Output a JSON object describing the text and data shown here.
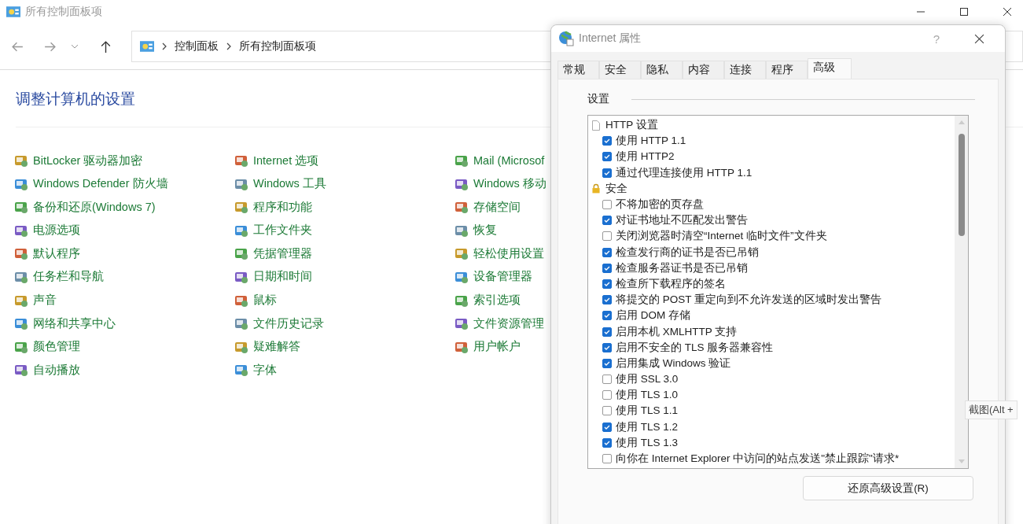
{
  "window": {
    "title": "所有控制面板项"
  },
  "address_bar": {
    "segments": [
      "控制面板",
      "所有控制面板项"
    ]
  },
  "heading": "调整计算机的设置",
  "items": [
    {
      "label": "BitLocker 驱动器加密"
    },
    {
      "label": "Windows Defender 防火墙"
    },
    {
      "label": "备份和还原(Windows 7)"
    },
    {
      "label": "电源选项"
    },
    {
      "label": "默认程序"
    },
    {
      "label": "任务栏和导航"
    },
    {
      "label": "声音"
    },
    {
      "label": "网络和共享中心"
    },
    {
      "label": "颜色管理"
    },
    {
      "label": "自动播放"
    },
    {
      "label": "Internet 选项"
    },
    {
      "label": "Windows 工具"
    },
    {
      "label": "程序和功能"
    },
    {
      "label": "工作文件夹"
    },
    {
      "label": "凭据管理器"
    },
    {
      "label": "日期和时间"
    },
    {
      "label": "鼠标"
    },
    {
      "label": "文件历史记录"
    },
    {
      "label": "疑难解答"
    },
    {
      "label": "字体"
    },
    {
      "label": "Mail (Microsof"
    },
    {
      "label": "Windows 移动"
    },
    {
      "label": "存储空间"
    },
    {
      "label": "恢复"
    },
    {
      "label": "轻松使用设置"
    },
    {
      "label": "设备管理器"
    },
    {
      "label": "索引选项"
    },
    {
      "label": "文件资源管理"
    },
    {
      "label": "用户帐户"
    }
  ],
  "dialog": {
    "title": "Internet 属性",
    "help": "?",
    "tabs": [
      {
        "label": "常规",
        "selected": false
      },
      {
        "label": "安全",
        "selected": false
      },
      {
        "label": "隐私",
        "selected": false
      },
      {
        "label": "内容",
        "selected": false
      },
      {
        "label": "连接",
        "selected": false
      },
      {
        "label": "程序",
        "selected": false
      },
      {
        "label": "高级",
        "selected": true
      }
    ],
    "group_label": "设置",
    "settings": [
      {
        "kind": "page",
        "label": "HTTP 设置"
      },
      {
        "kind": "checkbox",
        "label": "使用 HTTP 1.1",
        "checked": true
      },
      {
        "kind": "checkbox",
        "label": "使用 HTTP2",
        "checked": true
      },
      {
        "kind": "checkbox",
        "label": "通过代理连接使用 HTTP 1.1",
        "checked": true
      },
      {
        "kind": "lock",
        "label": "安全"
      },
      {
        "kind": "checkbox",
        "label": "不将加密的页存盘",
        "checked": false
      },
      {
        "kind": "checkbox",
        "label": "对证书地址不匹配发出警告",
        "checked": true
      },
      {
        "kind": "checkbox",
        "label": "关闭浏览器时清空“Internet 临时文件”文件夹",
        "checked": false
      },
      {
        "kind": "checkbox",
        "label": "检查发行商的证书是否已吊销",
        "checked": true
      },
      {
        "kind": "checkbox",
        "label": "检查服务器证书是否已吊销",
        "checked": true
      },
      {
        "kind": "checkbox",
        "label": "检查所下载程序的签名",
        "checked": true
      },
      {
        "kind": "checkbox",
        "label": "将提交的 POST 重定向到不允许发送的区域时发出警告",
        "checked": true
      },
      {
        "kind": "checkbox",
        "label": "启用 DOM 存储",
        "checked": true
      },
      {
        "kind": "checkbox",
        "label": "启用本机 XMLHTTP 支持",
        "checked": true
      },
      {
        "kind": "checkbox",
        "label": "启用不安全的 TLS 服务器兼容性",
        "checked": true
      },
      {
        "kind": "checkbox",
        "label": "启用集成 Windows 验证",
        "checked": true
      },
      {
        "kind": "checkbox",
        "label": "使用 SSL 3.0",
        "checked": false
      },
      {
        "kind": "checkbox",
        "label": "使用 TLS 1.0",
        "checked": false
      },
      {
        "kind": "checkbox",
        "label": "使用 TLS 1.1",
        "checked": false
      },
      {
        "kind": "checkbox",
        "label": "使用 TLS 1.2",
        "checked": true
      },
      {
        "kind": "checkbox",
        "label": "使用 TLS 1.3",
        "checked": true
      },
      {
        "kind": "checkbox",
        "label": "向你在 Internet Explorer 中访问的站点发送\"禁止跟踪\"请求*",
        "checked": false
      }
    ],
    "reset_button": "还原高级设置(R)"
  },
  "tooltip": "截图(Alt +"
}
